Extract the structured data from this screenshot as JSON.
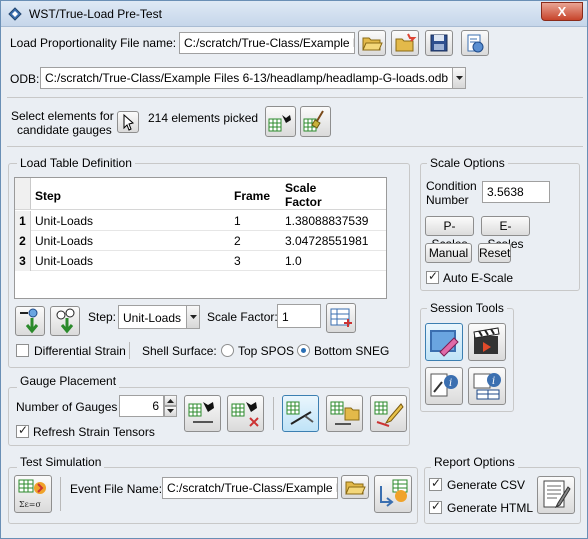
{
  "window": {
    "title": "WST/True-Load Pre-Test",
    "close_label": "X"
  },
  "load_prop": {
    "label": "Load Proportionality File name:",
    "value": "C:/scratch/True-Class/Example F"
  },
  "odb": {
    "label": "ODB:",
    "value": "C:/scratch/True-Class/Example Files 6-13/headlamp/headlamp-G-loads.odb"
  },
  "select": {
    "label_line1": "Select elements for",
    "label_line2": "candidate gauges",
    "picked": "214 elements picked"
  },
  "load_table": {
    "title": "Load Table Definition",
    "columns": [
      "Step",
      "Frame",
      "Scale Factor"
    ],
    "rows": [
      {
        "num": "1",
        "step": "Unit-Loads",
        "frame": "1",
        "scale": "1.38088837539"
      },
      {
        "num": "2",
        "step": "Unit-Loads",
        "frame": "2",
        "scale": "3.04728551981"
      },
      {
        "num": "3",
        "step": "Unit-Loads",
        "frame": "3",
        "scale": "1.0"
      }
    ],
    "step_label": "Step:",
    "step_value": "Unit-Loads",
    "scale_factor_label": "Scale Factor:",
    "scale_factor_value": "1",
    "differential_strain": "Differential Strain",
    "shell_surface": "Shell Surface:",
    "top_spos": "Top SPOS",
    "bottom_sneg": "Bottom SNEG"
  },
  "scale_options": {
    "title": "Scale Options",
    "condition_label_1": "Condition",
    "condition_label_2": "Number",
    "condition_value": "3.5638",
    "p_scales": "P-Scales",
    "e_scales": "E-Scales",
    "manual": "Manual",
    "reset": "Reset",
    "auto_e_scale": "Auto E-Scale"
  },
  "session_tools": {
    "title": "Session Tools"
  },
  "gauge": {
    "title": "Gauge Placement",
    "num_label": "Number of Gauges",
    "num_value": "6",
    "refresh": "Refresh Strain Tensors"
  },
  "test_sim": {
    "title": "Test Simulation",
    "event_label": "Event File Name:",
    "event_value": "C:/scratch/True-Class/Example F"
  },
  "report": {
    "title": "Report Options",
    "csv": "Generate CSV",
    "html": "Generate HTML"
  }
}
